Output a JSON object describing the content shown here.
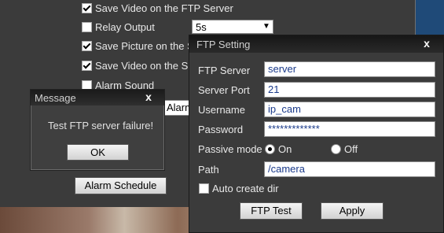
{
  "background": {
    "items": [
      {
        "label": "Save Video on the FTP Server",
        "checked": true
      },
      {
        "label": "Relay Output",
        "checked": false
      },
      {
        "label": "Save Picture on the S",
        "checked": true
      },
      {
        "label": "Save Video on the SD",
        "checked": true
      },
      {
        "label": "Alarm Sound",
        "checked": false
      }
    ],
    "relay_value": "5s",
    "alarm_partial": "Alarm",
    "alarm_schedule_button": "Alarm Schedule"
  },
  "message_dialog": {
    "title": "Message",
    "close": "x",
    "text": "Test FTP server failure!",
    "ok": "OK"
  },
  "ftp_dialog": {
    "title": "FTP Setting",
    "close": "x",
    "fields": {
      "server_label": "FTP Server",
      "server_value": "server",
      "port_label": "Server Port",
      "port_value": "21",
      "username_label": "Username",
      "username_value": "ip_cam",
      "password_label": "Password",
      "password_value": "*************",
      "passive_label": "Passive mode",
      "passive_on": "On",
      "passive_off": "Off",
      "path_label": "Path",
      "path_value": "/camera"
    },
    "auto_create_dir": "Auto create dir",
    "ftp_test_button": "FTP Test",
    "apply_button": "Apply"
  }
}
